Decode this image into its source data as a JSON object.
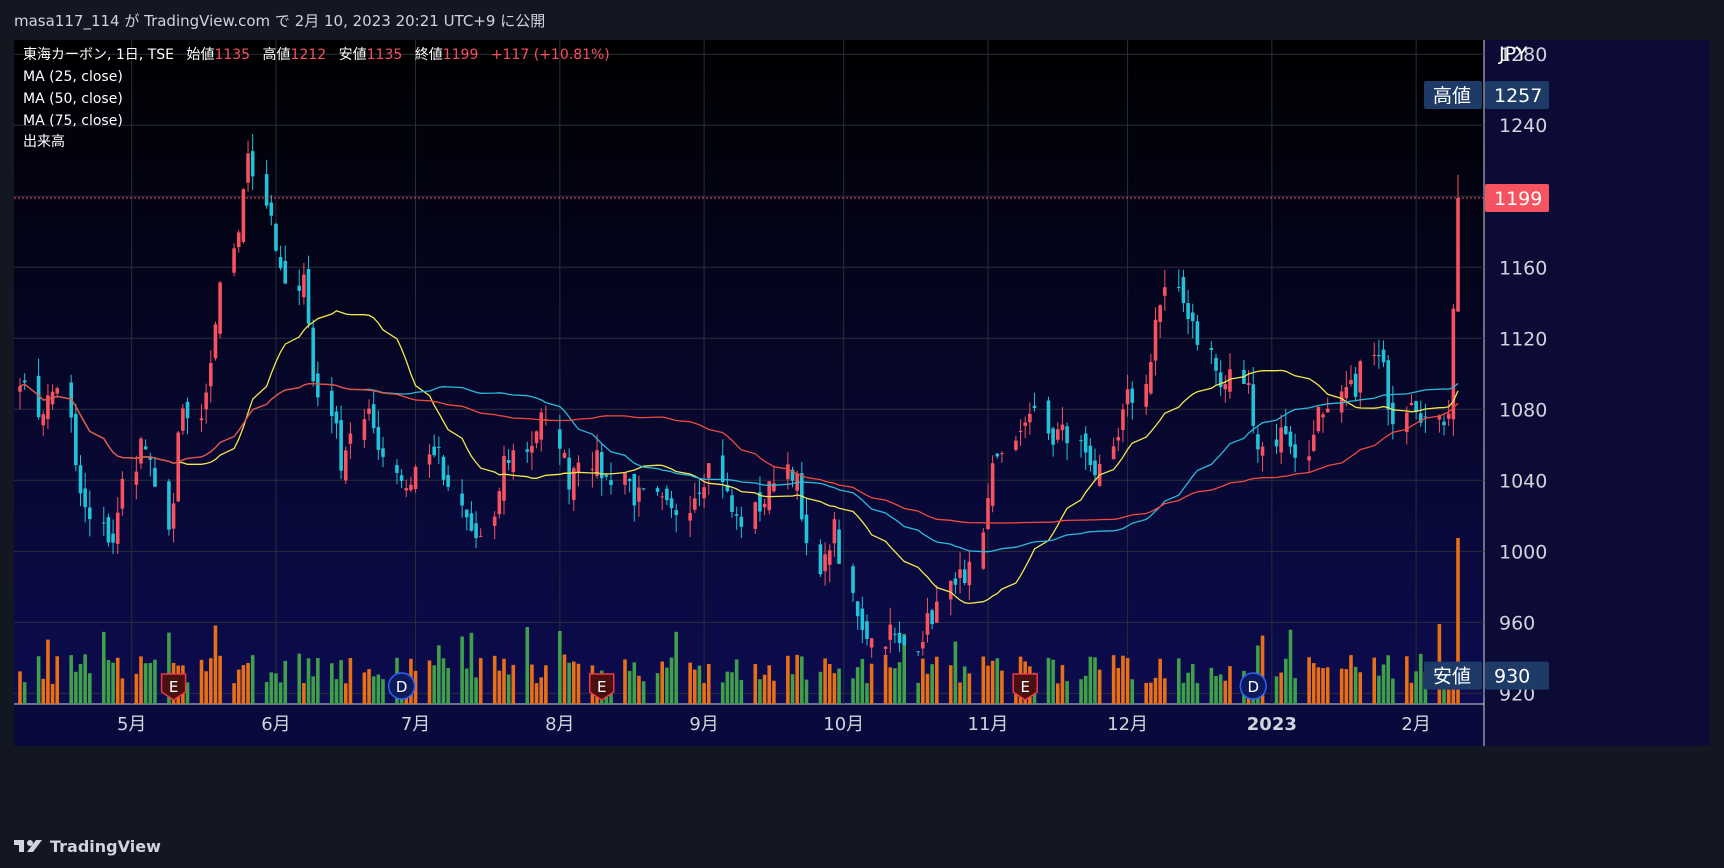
{
  "header": {
    "publish_text": "masa117_114 が TradingView.com で 2月 10, 2023 20:21 UTC+9 に公開"
  },
  "footer": {
    "brand": "TradingView",
    "logo_icon": "tradingview-logo-icon"
  },
  "legend": {
    "symbol_line": "東海カーボン, 1日, TSE",
    "open_label": "始値",
    "open_value": "1135",
    "high_label": "高値",
    "high_value": "1212",
    "low_label": "安値",
    "low_value": "1135",
    "close_label": "終値",
    "close_value": "1199",
    "change": "+117 (+10.81%)",
    "ma25": "MA (25, close)",
    "ma50": "MA (50, close)",
    "ma75": "MA (75, close)",
    "volume": "出来高"
  },
  "price_axis": {
    "currency": "JPY",
    "ticks": [
      1280,
      1240,
      1160,
      1120,
      1080,
      1040,
      1000,
      960,
      920
    ],
    "high_badge_label": "高値",
    "high_badge_value": "1257",
    "current_value": "1199",
    "low_badge_label": "安値",
    "low_badge_value": "930"
  },
  "colors": {
    "background_top": "#000000",
    "background_bottom": "#0c0c50",
    "up": "#f7525f",
    "down": "#22c3d8",
    "vol_up": "#e76f17",
    "vol_down": "#3f9f4a",
    "ma25": "#f2e74c",
    "ma50": "#2bb9d8",
    "ma75": "#ef4a3c",
    "current": "#f7525f",
    "badge": "#1e3a66"
  },
  "chart_data": {
    "type": "candlestick",
    "title": "東海カーボン, 1日, TSE",
    "ylabel": "JPY",
    "ylim": [
      914,
      1288
    ],
    "x_ticks": [
      "5月",
      "6月",
      "7月",
      "8月",
      "9月",
      "10月",
      "11月",
      "12月",
      "2023",
      "2月"
    ],
    "x_tick_dates": [
      "2022-05-01",
      "2022-06-01",
      "2022-07-01",
      "2022-08-01",
      "2022-09-01",
      "2022-10-01",
      "2022-11-01",
      "2022-12-01",
      "2023-01-01",
      "2023-02-01"
    ],
    "date_range": [
      "2022-04-07",
      "2023-02-10"
    ],
    "last": {
      "open": 1135,
      "high": 1212,
      "low": 1135,
      "close": 1199,
      "change": 117,
      "change_pct": 10.81
    },
    "price_path": [
      1100,
      1078,
      1085,
      1095,
      1040,
      1020,
      1010,
      1006,
      1045,
      1065,
      1040,
      1010,
      1080,
      1070,
      1090,
      1150,
      1175,
      1230,
      1200,
      1170,
      1145,
      1160,
      1095,
      1080,
      1050,
      1070,
      1075,
      1060,
      1045,
      1035,
      1050,
      1060,
      1035,
      1020,
      1008,
      1005,
      1050,
      1055,
      1060,
      1075,
      1065,
      1040,
      1055,
      1050,
      1040,
      1045,
      1030,
      1030,
      1025,
      1020,
      1030,
      1040,
      1050,
      1025,
      1015,
      1025,
      1030,
      1050,
      1045,
      1000,
      990,
      1015,
      975,
      960,
      950,
      955,
      945,
      950,
      960,
      970,
      990,
      975,
      1010,
      1060,
      1050,
      1075,
      1080,
      1060,
      1070,
      1060,
      1055,
      1040,
      1060,
      1085,
      1090,
      1130,
      1145,
      1140,
      1130,
      1110,
      1090,
      1100,
      1090,
      1055,
      1065,
      1070,
      1045,
      1080,
      1070,
      1090,
      1090,
      1110,
      1105,
      1075,
      1090,
      1080,
      1070,
      1080,
      1199
    ],
    "volume_relative": "candle-colored volume bars, largest on last session",
    "events": [
      {
        "type": "E",
        "date": "2022-05-10"
      },
      {
        "type": "D",
        "date": "2022-06-28"
      },
      {
        "type": "E",
        "date": "2022-08-10"
      },
      {
        "type": "E",
        "date": "2022-11-09"
      },
      {
        "type": "D",
        "date": "2022-12-28"
      }
    ],
    "ma_levels_last": {
      "ma25": 1088,
      "ma50": 1095,
      "ma75": 1072
    }
  }
}
